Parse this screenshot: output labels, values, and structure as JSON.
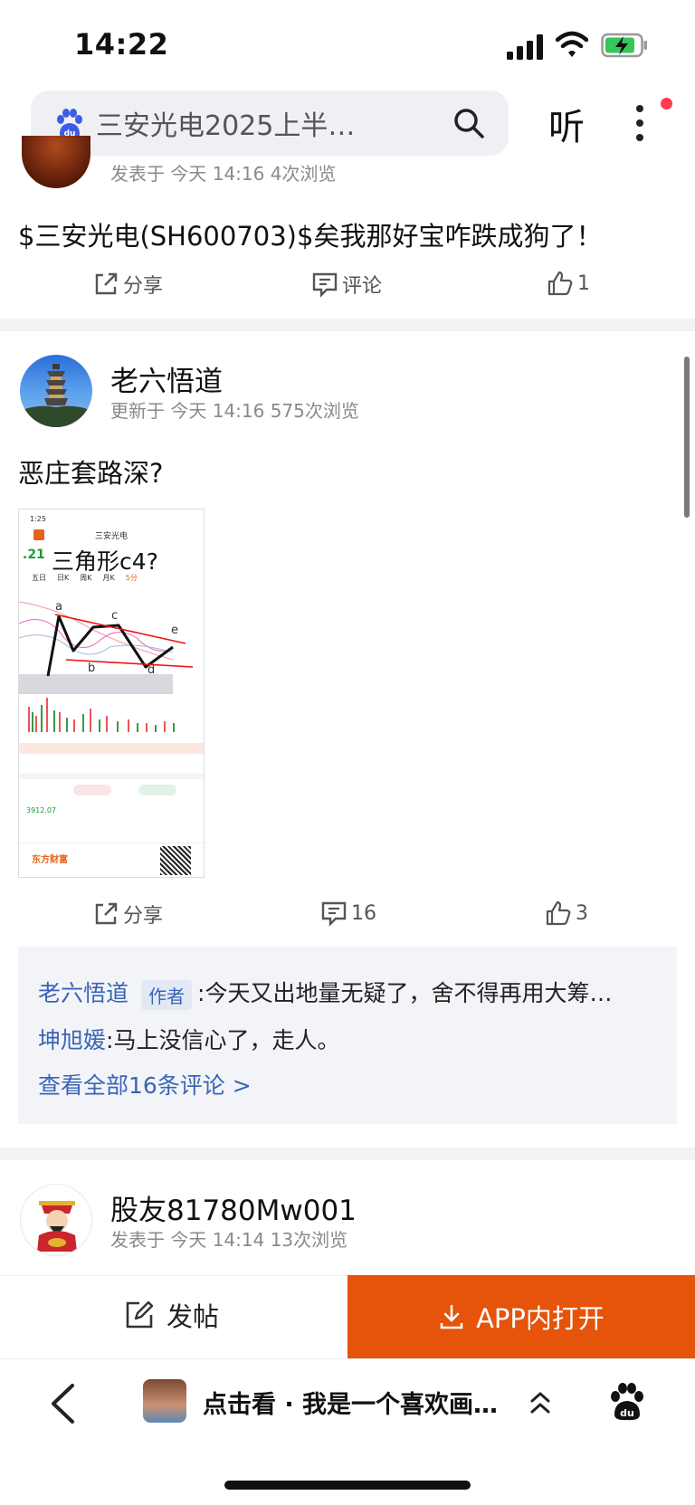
{
  "status_bar": {
    "time": "14:22"
  },
  "search": {
    "query": "三安光电2025上半…",
    "listen_label": "听"
  },
  "post1": {
    "meta": "发表于 今天 14:16   4次浏览",
    "text": "$三安光电(SH600703)$矣我那好宝咋跌成狗了！",
    "share_label": "分享",
    "comment_label": "评论",
    "like_count": "1"
  },
  "post2": {
    "author": "老六悟道",
    "meta": "更新于 今天 14:16   575次浏览",
    "text": "恶庄套路深?",
    "image": {
      "time": "1:25",
      "stock_name": "三安光电",
      "overlay": "三角形c4?",
      "tabs": [
        "五日",
        "日K",
        "周K",
        "月K",
        "5分"
      ],
      "labels": [
        "a",
        "b",
        "c",
        "d",
        "e"
      ],
      "price": "3912.07",
      "brand": "东方财富"
    },
    "share_label": "分享",
    "comment_count": "16",
    "like_count": "3",
    "comments": [
      {
        "name": "老六悟道",
        "tag": "作者",
        "text": ":今天又出地量无疑了，舍不得再用大筹…"
      },
      {
        "name": "坤旭媛",
        "text": ":马上没信心了，走人。"
      }
    ],
    "view_all": "查看全部16条评论 >"
  },
  "post3": {
    "author": "股友81780Mw001",
    "meta": "发表于 今天 14:14   13次浏览"
  },
  "bottom": {
    "post_label": "发帖",
    "open_app_label": "APP内打开"
  },
  "nav": {
    "story_text": "点击看 · 我是一个喜欢画…"
  },
  "colors": {
    "accent_orange": "#e6530a",
    "link_blue": "#3a65b5",
    "notify_red": "#ff3b4e"
  }
}
